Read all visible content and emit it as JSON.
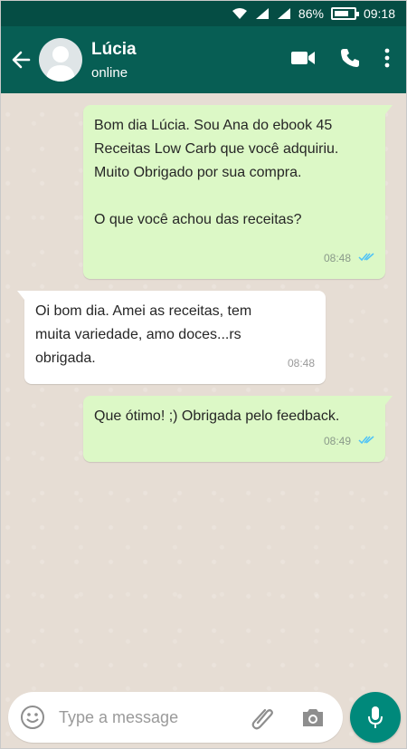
{
  "status_bar": {
    "battery_percent": "86%",
    "time": "09:18",
    "icons": [
      "wifi-icon",
      "signal-icon",
      "signal-icon",
      "battery-icon"
    ]
  },
  "header": {
    "contact_name": "Lúcia",
    "contact_status": "online",
    "icons": [
      "back-arrow-icon",
      "avatar-placeholder-icon",
      "video-call-icon",
      "phone-icon",
      "more-vert-icon"
    ]
  },
  "messages": [
    {
      "direction": "outgoing",
      "text": "Bom dia Lúcia. Sou Ana do ebook 45\nReceitas Low Carb que você adquiriu.\nMuito Obrigado por sua compra.\n\nO que você achou das receitas?",
      "time": "08:48",
      "read": true
    },
    {
      "direction": "incoming",
      "text": "Oi bom dia. Amei as receitas, tem\nmuita variedade, amo doces...rs\nobrigada.",
      "time": "08:48"
    },
    {
      "direction": "outgoing",
      "text": "Que ótimo! ;) Obrigada pelo feedback.",
      "time": "08:49",
      "read": true
    }
  ],
  "composer": {
    "placeholder": "Type a message",
    "icons": [
      "emoji-icon",
      "attach-icon",
      "camera-icon",
      "mic-icon"
    ]
  },
  "colors": {
    "header": "#075e54",
    "status_bar": "#054d44",
    "outgoing_bubble": "#dcf8c6",
    "incoming_bubble": "#ffffff",
    "read_ticks": "#4fc3f7",
    "mic_button": "#00897b"
  }
}
